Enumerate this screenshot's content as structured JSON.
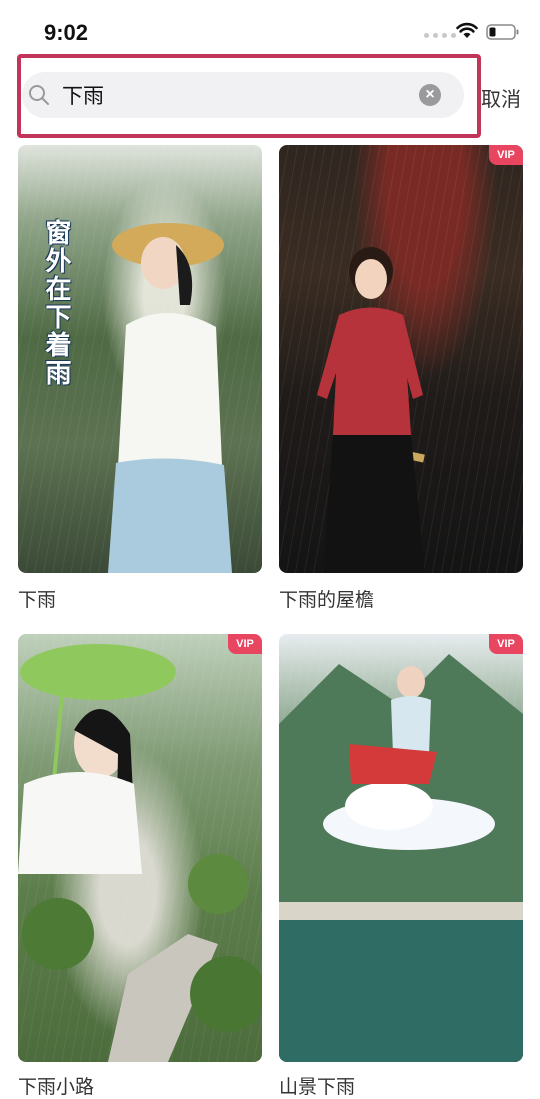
{
  "status": {
    "time": "9:02"
  },
  "search": {
    "value": "下雨",
    "cancel_label": "取消"
  },
  "results": [
    {
      "title": "下雨",
      "vip": "",
      "overlay_text": "窗外在下着雨"
    },
    {
      "title": "下雨的屋檐",
      "vip": "VIP"
    },
    {
      "title": "下雨小路",
      "vip": "VIP"
    },
    {
      "title": "山景下雨",
      "vip": "VIP"
    }
  ],
  "colors": {
    "highlight": "#c3345a",
    "vip": "#e84561"
  }
}
